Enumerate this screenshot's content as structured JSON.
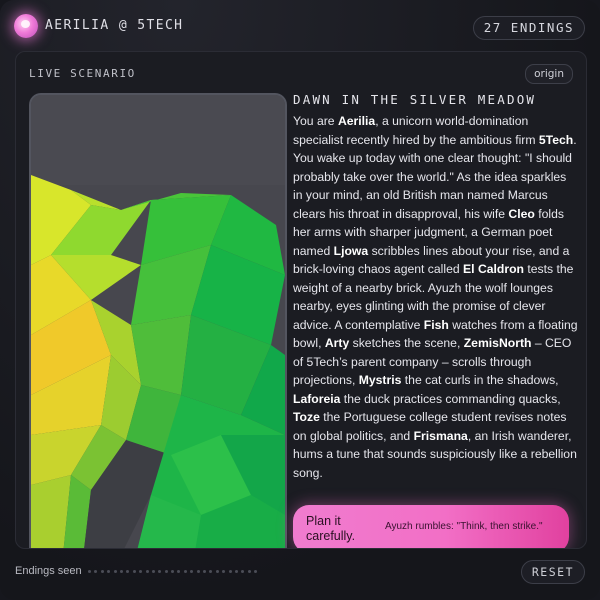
{
  "header": {
    "brand": "AERILIA @ 5TECH",
    "endings_badge": "27 ENDINGS"
  },
  "card": {
    "label": "LIVE SCENARIO",
    "origin_label": "origin",
    "scene_title": "DAWN IN THE SILVER MEADOW",
    "story": [
      {
        "t": "You are "
      },
      {
        "t": "Aerilia",
        "b": true
      },
      {
        "t": ", a unicorn world-domination specialist recently hired by the ambitious firm "
      },
      {
        "t": "5Tech",
        "b": true
      },
      {
        "t": ". You wake up today with one clear thought: \"I should probably take over the world.\" As the idea sparkles in your mind, an old British man named Marcus clears his throat in disapproval, his wife "
      },
      {
        "t": "Cleo",
        "b": true
      },
      {
        "t": " folds her arms with sharper judgment, a German poet named "
      },
      {
        "t": "Ljowa",
        "b": true
      },
      {
        "t": " scribbles lines about your rise, and a brick-loving chaos agent called "
      },
      {
        "t": "El Caldron",
        "b": true
      },
      {
        "t": " tests the weight of a nearby brick. Ayuzh the wolf lounges nearby, eyes glinting with the promise of clever advice. A contemplative "
      },
      {
        "t": "Fish",
        "b": true
      },
      {
        "t": " watches from a floating bowl, "
      },
      {
        "t": "Arty",
        "b": true
      },
      {
        "t": " sketches the scene, "
      },
      {
        "t": "ZemisNorth",
        "b": true
      },
      {
        "t": " – CEO of 5Tech’s parent company – scrolls through projections, "
      },
      {
        "t": "Mystris",
        "b": true
      },
      {
        "t": " the cat curls in the shadows, "
      },
      {
        "t": "Laforeia",
        "b": true
      },
      {
        "t": " the duck practices commanding quacks, "
      },
      {
        "t": "Toze",
        "b": true
      },
      {
        "t": " the Portuguese college student revises notes on global politics, and "
      },
      {
        "t": "Frismana",
        "b": true
      },
      {
        "t": ", an Irish wanderer, hums a tune that sounds suspiciously like a rebellion song."
      }
    ],
    "choice": {
      "label": "Plan it carefully.",
      "hint": "Ayuzh rumbles: \"Think, then strike.\""
    }
  },
  "footer": {
    "endings_label": "Endings seen",
    "progress_seen": 0,
    "progress_total": 27,
    "reset_label": "RESET"
  },
  "icons": {
    "logo": "unicorn-orb-icon"
  },
  "colors": {
    "accent_pink": "#f26fc6",
    "background": "#16171d",
    "art_green": "#2fbf3a",
    "art_yellow": "#d6e12a"
  }
}
